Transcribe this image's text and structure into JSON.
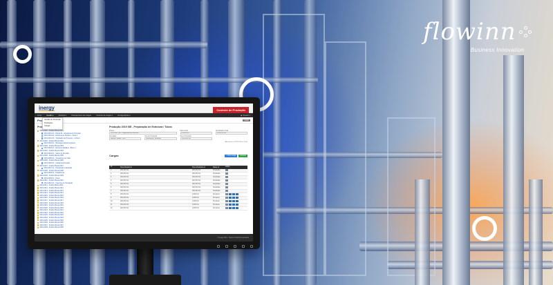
{
  "brand": {
    "name": "flowinn",
    "tagline": "Business Innovation"
  },
  "app": {
    "logo": "inergy",
    "module_badge": "Controle de Produção",
    "menu": [
      "Início",
      "Gestão ▾",
      "Medição ▾",
      "Planejamento de Cargas",
      "Controle de cargas ▾",
      "Configurações ▾"
    ],
    "user": "◉ Usuário ▾",
    "dropdown": [
      "Gestão de Produção",
      "Produções",
      "Cargas"
    ],
    "page_title": "Produções",
    "back_button": "Voltar",
    "tree_label": "Produções",
    "tree_rows": [
      "2019-0001 - Pedido Planta 0001",
      "2019-0001-01 - Planta 01 - Equipamento Principal",
      "2019-0001-02 - Estrutura de Suporte - Nível 1",
      "2019-0001-03 - Tubulação de Processo - Linha A",
      "2019-0002 - Pedido Planta 0002",
      "2019-0002-01 - Montagem Eletromecânica",
      "2019-0003 - Pedido Planta 0003",
      "2019-0003-01 - Estrutura Metálica - Bloco 1",
      "2019-0004 - Pedido Planta 0004",
      "2019-0004-01 - Vasos de Pressão",
      "2019-0005 - Pedido Planta 0005",
      "2019-0005-01 - Trocadores de Calor",
      "2019-0006 - Pedido Planta 0006",
      "2019-0006-01 - Caldeiraria Pesada",
      "2019-0007 - Pedido Planta 0007",
      "2019-0007-01 - Passarelas e Escadas",
      "2019-0008 - Pedido Planta 0008",
      "2019-0008-01 - Plataformas",
      "2019-0009 - Pedido Planta 0009",
      "2019-0009-01 - Dutos",
      "2019-0010 - Pedido Planta 0010",
      "2019-0010-01 - Suportes de Tubulação",
      "2019-0011 - Pedido Planta 0011",
      "2019-0012 - Pedido Planta 0012",
      "2019-0013 - Pedido Planta 0013",
      "2019-0014 - Pedido Planta 0014",
      "2019-0015 - Pedido Planta 0015",
      "2019-0016 - Pedido Planta 0016",
      "2019-0017 - Pedido Planta 0017",
      "2019-0018 - Pedido Planta 0018",
      "2019-0019 - Pedido Planta 0019",
      "2019-0020 - Pedido Planta 0020",
      "2019-0021 - Pedido Planta 0021",
      "2019-0022 - Pedido Planta 0022",
      "2019-0023 - Pedido Planta 0023",
      "2019-0024 - Pedido Planta 0024",
      "2019-0025 - Pedido Planta 0025",
      "2019-0026 - Pedido Planta 0026",
      "2019-0027 - Pedido Planta 0027",
      "2019-0028 - Pedido Planta 0028"
    ],
    "detail": {
      "heading": "Produção 2019 ISE - Preparação de Estrutura / Tubos",
      "fields": [
        {
          "label": "Projeto",
          "value": "2019-0001 ISE - Preparação de Estrutura",
          "wide": true
        },
        {
          "label": "Data Inicial",
          "value": "01/08/2019"
        },
        {
          "label": "Quantidade Inicial",
          "value": "10.000,00 KG"
        },
        {
          "label": "Prioridade",
          "value": "Normal / Média - 2019"
        },
        {
          "label": "Tipo de Produção",
          "value": "Fabricação / Estrutura"
        },
        {
          "label": "Peso Produzido",
          "value": "1.400,000 KG"
        }
      ],
      "meta": "Alterado em 12/12/2019 às 10:30"
    },
    "cargas": {
      "title": "Cargas",
      "btn_new": "+ Nova Carga",
      "btn_export": "Exportar",
      "headers": [
        "Nº",
        "Peso Previsto ⬍",
        "",
        "Peso Produzido ⬍",
        "Status ⬍",
        "Ações"
      ],
      "rows": [
        [
          "1",
          "200,000 KG",
          "200,000 KG",
          "Finalizada",
          1
        ],
        [
          "2",
          "200,000 KG",
          "200,000 KG",
          "Finalizada",
          1
        ],
        [
          "3",
          "200,000 KG",
          "200,000 KG",
          "Finalizada",
          1
        ],
        [
          "4",
          "200,000 KG",
          "200,000 KG",
          "Finalizada",
          1
        ],
        [
          "5",
          "200,000 KG",
          "200,000 KG",
          "Finalizada",
          1
        ],
        [
          "6",
          "200,000 KG",
          "200,000 KG",
          "Finalizada",
          1
        ],
        [
          "7",
          "200,000 KG",
          "200,000 KG",
          "Finalizada",
          1
        ],
        [
          "8",
          "200,000 KG",
          "0,000 KG",
          "Pendente",
          4
        ],
        [
          "9",
          "200,000 KG",
          "0,000 KG",
          "Pendente",
          4
        ],
        [
          "10",
          "200,000 KG",
          "0,000 KG",
          "Pendente",
          4
        ],
        [
          "11",
          "200,000 KG",
          "0,000 KG",
          "Pendente",
          4
        ],
        [
          "12",
          "200,000 KG",
          "0,000 KG",
          "Pendente",
          4
        ]
      ]
    },
    "footer": "© Inergy 2019 - Todos os direitos reservados"
  },
  "colors": {
    "accent_red": "#c8222b",
    "accent_blue": "#2f78d6",
    "accent_green": "#2d9e49"
  }
}
